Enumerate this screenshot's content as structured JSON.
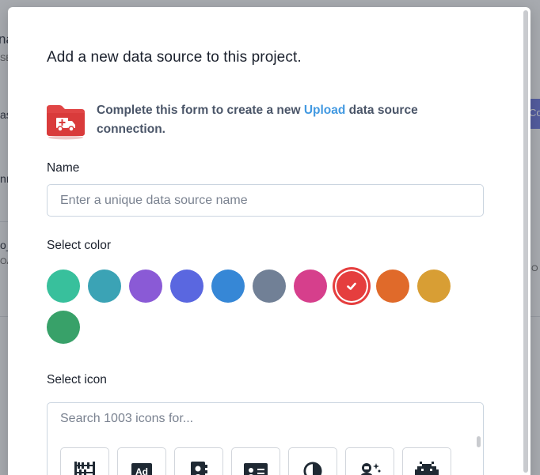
{
  "background": {
    "fragments": [
      "na",
      "SE",
      "as",
      "nı",
      "o_",
      "OA",
      "O"
    ],
    "button_fragment": "Co"
  },
  "modal": {
    "title": "Add a new data source to this project.",
    "intro": {
      "icon": "ambulance-folder-icon",
      "text_before": "Complete this form to create a new ",
      "link_text": "Upload",
      "text_after": " data source connection."
    },
    "name": {
      "label": "Name",
      "placeholder": "Enter a unique data source name",
      "value": ""
    },
    "color": {
      "label": "Select color",
      "selected": "red",
      "options": [
        {
          "name": "teal",
          "hex": "#38c09c"
        },
        {
          "name": "cyan",
          "hex": "#3ba3b5"
        },
        {
          "name": "purple",
          "hex": "#8a5ad6"
        },
        {
          "name": "indigo",
          "hex": "#5a67e0"
        },
        {
          "name": "blue",
          "hex": "#3687d6"
        },
        {
          "name": "gray",
          "hex": "#718096"
        },
        {
          "name": "pink",
          "hex": "#d63f8c"
        },
        {
          "name": "red",
          "hex": "#e53e3e"
        },
        {
          "name": "orange",
          "hex": "#e06a2a"
        },
        {
          "name": "yellow",
          "hex": "#d89e34"
        },
        {
          "name": "green",
          "hex": "#38a169"
        }
      ]
    },
    "icon": {
      "label": "Select icon",
      "search_placeholder": "Search 1003 icons for...",
      "tiles": [
        {
          "name": "abacus-icon"
        },
        {
          "name": "ad-icon",
          "text": "Ad"
        },
        {
          "name": "address-book-icon"
        },
        {
          "name": "address-card-icon"
        },
        {
          "name": "adjust-icon"
        },
        {
          "name": "user-astronaut-icon"
        },
        {
          "name": "space-invader-icon"
        }
      ]
    }
  }
}
